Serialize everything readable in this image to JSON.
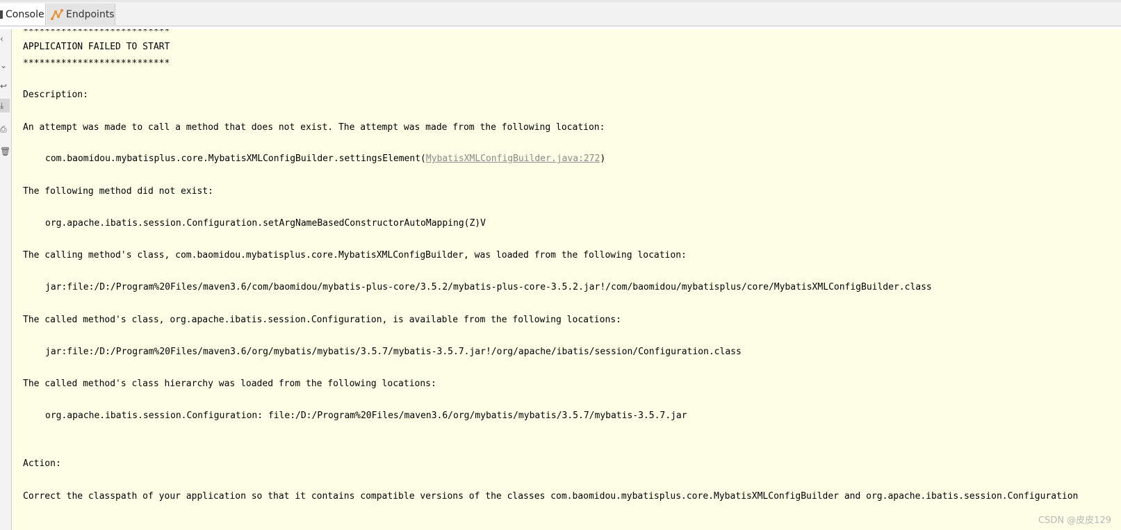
{
  "tabs": [
    {
      "label": "Console"
    },
    {
      "label": "Endpoints"
    }
  ],
  "gutter_icons": [
    "up-icon",
    "down-icon",
    "wrap-icon",
    "scroll-to-end-icon",
    "print-icon",
    "clear-icon"
  ],
  "console": {
    "lines": [
      "***************************",
      "APPLICATION FAILED TO START",
      "***************************",
      "Description:",
      "An attempt was made to call a method that does not exist. The attempt was made from the following location:",
      "com.baomidou.mybatisplus.core.MybatisXMLConfigBuilder.settingsElement(",
      "MybatisXMLConfigBuilder.java:272",
      ")",
      "The following method did not exist:",
      "org.apache.ibatis.session.Configuration.setArgNameBasedConstructorAutoMapping(Z)V",
      "The calling method's class, com.baomidou.mybatisplus.core.MybatisXMLConfigBuilder, was loaded from the following location:",
      "jar:file:/D:/Program%20Files/maven3.6/com/baomidou/mybatis-plus-core/3.5.2/mybatis-plus-core-3.5.2.jar!/com/baomidou/mybatisplus/core/MybatisXMLConfigBuilder.class",
      "The called method's class, org.apache.ibatis.session.Configuration, is available from the following locations:",
      "jar:file:/D:/Program%20Files/maven3.6/org/mybatis/mybatis/3.5.7/mybatis-3.5.7.jar!/org/apache/ibatis/session/Configuration.class",
      "The called method's class hierarchy was loaded from the following locations:",
      "org.apache.ibatis.session.Configuration: file:/D:/Program%20Files/maven3.6/org/mybatis/mybatis/3.5.7/mybatis-3.5.7.jar",
      "Action:",
      "Correct the classpath of your application so that it contains compatible versions of the classes com.baomidou.mybatisplus.core.MybatisXMLConfigBuilder and org.apache.ibatis.session.Configuration"
    ]
  },
  "watermark": "CSDN @皮皮129",
  "colors": {
    "console_bg": "#fefee6",
    "link": "#8a8a8a",
    "endpoints_icon": "#e8912d"
  }
}
